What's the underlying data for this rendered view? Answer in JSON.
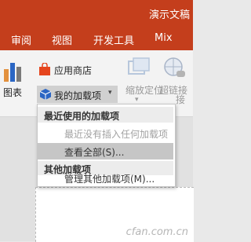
{
  "app": {
    "title": "演示文稿"
  },
  "tabs": [
    {
      "label": "审阅"
    },
    {
      "label": "视图"
    },
    {
      "label": "开发工具"
    },
    {
      "label": "Mix"
    }
  ],
  "ribbon": {
    "chart_label": "图表",
    "store_label": "应用商店",
    "my_addins_label": "我的加载项",
    "zoom_label": "缩放定位",
    "hyperlink_label": "超链接",
    "group_label": "接"
  },
  "dropdown": {
    "recent_header": "最近使用的加载项",
    "no_recent": "最近没有插入任何加载项",
    "view_all": "查看全部(S)...",
    "other_header": "其他加载项",
    "manage_other": "管理其他加载项(M)..."
  },
  "watermark": "cfan.com.cn",
  "colors": {
    "accent": "#c43e1c",
    "store_icon": "#e5451d",
    "addin_icon": "#2b66c4"
  }
}
